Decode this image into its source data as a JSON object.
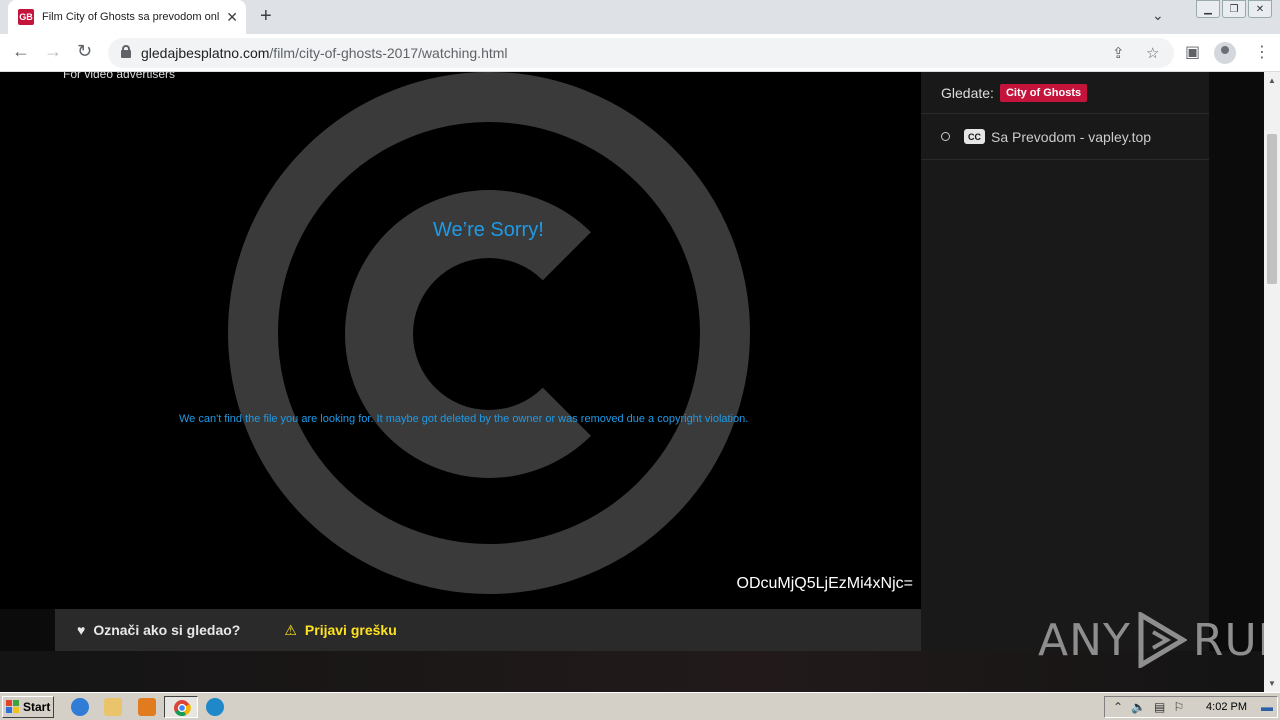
{
  "browser": {
    "tab_title": "Film City of Ghosts sa prevodom online",
    "favicon_text": "GB",
    "url_host": "gledajbesplatno.com",
    "url_path": "/film/city-of-ghosts-2017/watching.html"
  },
  "player": {
    "ad_text": "For video advertisers",
    "sorry_title": "We’re Sorry!",
    "error_message": "We can't find the file you are looking for. It maybe got deleted by the owner or was removed due a copyright violation.",
    "code": "ODcuMjQ5LjEzMi4xNjc=",
    "accent_color": "#1e9be8"
  },
  "actions": {
    "mark_watched": "Označi ako si gledao?",
    "report_error": "Prijavi grešku"
  },
  "sidebar": {
    "watching_label": "Gledate:",
    "watching_title": "City of Ghosts",
    "cc_text": "CC",
    "source_label": "Sa Prevodom - vapley.top",
    "badge_color": "#c4143c"
  },
  "watermark": {
    "left": "ANY",
    "right": "RUN"
  },
  "taskbar": {
    "start_label": "Start",
    "clock": "4:02 PM"
  }
}
